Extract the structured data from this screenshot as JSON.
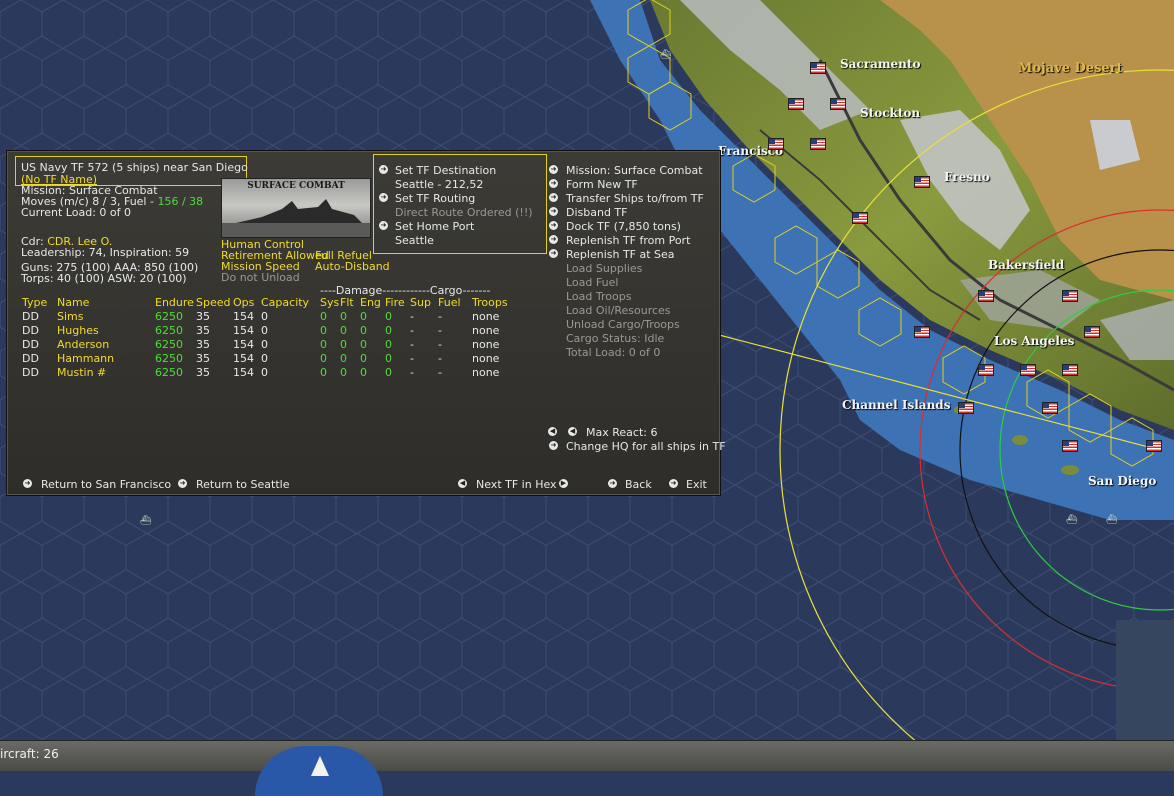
{
  "map": {
    "labels": {
      "sacramento": "Sacramento",
      "stockton": "Stockton",
      "fresno": "Fresno",
      "bakersfield": "Bakersfield",
      "los_angeles": "Los Angeles",
      "channel_islands": "Channel Islands",
      "san_diego": "San Diego",
      "mojave": "Mojave Desert",
      "francisco": "Francisco"
    },
    "colors": {
      "ocean": "#2b3a5c",
      "coast": "#3b6fb0",
      "land": "#7b8c3a",
      "desert": "#b8924a"
    }
  },
  "panel": {
    "tf_title": "US Navy TF 572 (5 ships)  near San Diego",
    "tf_name": "(No TF Name)",
    "mission": "Mission:  Surface Combat",
    "moves": "Moves (m/c)  8 / 3, Fuel - ",
    "fuel": "156 / 38",
    "current_load": "Current Load:  0 of 0",
    "cdr_label": "Cdr: ",
    "cdr_name": "CDR. Lee O.",
    "leadership": "Leadership: 74, Inspiration: 59",
    "guns": "Guns: 275 (100) AAA: 850 (100)",
    "torps": "Torps: 40 (100) ASW: 20 (100)",
    "image_caption": "SURFACE COMBAT",
    "opts": {
      "human_control": "Human Control",
      "retirement": "Retirement Allowed",
      "full_refuel": "Full Refuel",
      "mission_speed": "Mission Speed",
      "auto_disband": "Auto-Disband",
      "do_not_unload": "Do not Unload"
    },
    "middle": {
      "set_destination": "Set TF Destination",
      "destination": "Seattle - 212,52",
      "set_routing": "Set TF Routing",
      "direct_route": "Direct Route Ordered (!!)",
      "set_home_port": "Set Home Port",
      "home_port": "Seattle"
    },
    "right": {
      "mission": "Mission: Surface Combat",
      "form_new": "Form New TF",
      "transfer": "Transfer Ships to/from TF",
      "disband": "Disband TF",
      "dock": "Dock TF (7,850 tons)",
      "replenish_port": "Replenish TF from Port",
      "replenish_sea": "Replenish TF at Sea",
      "load_supplies": "Load Supplies",
      "load_fuel": "Load Fuel",
      "load_troops": "Load Troops",
      "load_oil": "Load Oil/Resources",
      "unload": "Unload Cargo/Troops",
      "cargo_status": "Cargo Status: Idle",
      "total_load": "Total Load:  0 of 0"
    },
    "table": {
      "group_header": "----Damage------------Cargo-------",
      "headers": [
        "Type",
        "Name",
        "Endure",
        "Speed",
        "Ops",
        "Capacity",
        "Sys",
        "Flt",
        "Eng",
        "Fire",
        "Sup",
        "Fuel",
        "Troops"
      ],
      "rows": [
        [
          "DD",
          "Sims",
          "6250",
          "35",
          "154",
          "0",
          "0",
          "0",
          "0",
          "0",
          "-",
          "-",
          "none"
        ],
        [
          "DD",
          "Hughes",
          "6250",
          "35",
          "154",
          "0",
          "0",
          "0",
          "0",
          "0",
          "-",
          "-",
          "none"
        ],
        [
          "DD",
          "Anderson",
          "6250",
          "35",
          "154",
          "0",
          "0",
          "0",
          "0",
          "0",
          "-",
          "-",
          "none"
        ],
        [
          "DD",
          "Hammann",
          "6250",
          "35",
          "154",
          "0",
          "0",
          "0",
          "0",
          "0",
          "-",
          "-",
          "none"
        ],
        [
          "DD",
          "Mustin #",
          "6250",
          "35",
          "154",
          "0",
          "0",
          "0",
          "0",
          "0",
          "-",
          "-",
          "none"
        ]
      ]
    },
    "max_react": "Max React:  6",
    "change_hq": "Change HQ for all ships in TF",
    "bottom": {
      "return_sf": "Return to San Francisco",
      "return_seattle": "Return to Seattle",
      "next_tf": "Next TF in Hex",
      "back": "Back",
      "exit": "Exit"
    }
  },
  "statusbar": {
    "aircraft": "ircraft: 26"
  }
}
